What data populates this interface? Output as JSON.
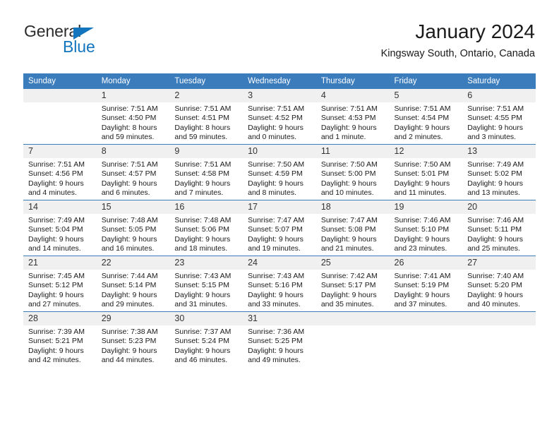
{
  "logo": {
    "word_one": "General",
    "word_two": "Blue",
    "triangle_icon": "triangle-icon",
    "accent_color": "#1275bd"
  },
  "header": {
    "title": "January 2024",
    "subtitle": "Kingsway South, Ontario, Canada"
  },
  "theme": {
    "header_row_bg": "#3b7cbd",
    "daynum_bg": "#f0f0f0",
    "grid_line": "#3b7cbd",
    "text": "#1a1a1a"
  },
  "calendar": {
    "weekday_headers": [
      "Sunday",
      "Monday",
      "Tuesday",
      "Wednesday",
      "Thursday",
      "Friday",
      "Saturday"
    ],
    "weeks": [
      [
        {
          "day": "",
          "sunrise": "",
          "sunset": "",
          "daylight_line1": "",
          "daylight_line2": "",
          "empty": true
        },
        {
          "day": "1",
          "sunrise": "Sunrise: 7:51 AM",
          "sunset": "Sunset: 4:50 PM",
          "daylight_line1": "Daylight: 8 hours",
          "daylight_line2": "and 59 minutes."
        },
        {
          "day": "2",
          "sunrise": "Sunrise: 7:51 AM",
          "sunset": "Sunset: 4:51 PM",
          "daylight_line1": "Daylight: 8 hours",
          "daylight_line2": "and 59 minutes."
        },
        {
          "day": "3",
          "sunrise": "Sunrise: 7:51 AM",
          "sunset": "Sunset: 4:52 PM",
          "daylight_line1": "Daylight: 9 hours",
          "daylight_line2": "and 0 minutes."
        },
        {
          "day": "4",
          "sunrise": "Sunrise: 7:51 AM",
          "sunset": "Sunset: 4:53 PM",
          "daylight_line1": "Daylight: 9 hours",
          "daylight_line2": "and 1 minute."
        },
        {
          "day": "5",
          "sunrise": "Sunrise: 7:51 AM",
          "sunset": "Sunset: 4:54 PM",
          "daylight_line1": "Daylight: 9 hours",
          "daylight_line2": "and 2 minutes."
        },
        {
          "day": "6",
          "sunrise": "Sunrise: 7:51 AM",
          "sunset": "Sunset: 4:55 PM",
          "daylight_line1": "Daylight: 9 hours",
          "daylight_line2": "and 3 minutes."
        }
      ],
      [
        {
          "day": "7",
          "sunrise": "Sunrise: 7:51 AM",
          "sunset": "Sunset: 4:56 PM",
          "daylight_line1": "Daylight: 9 hours",
          "daylight_line2": "and 4 minutes."
        },
        {
          "day": "8",
          "sunrise": "Sunrise: 7:51 AM",
          "sunset": "Sunset: 4:57 PM",
          "daylight_line1": "Daylight: 9 hours",
          "daylight_line2": "and 6 minutes."
        },
        {
          "day": "9",
          "sunrise": "Sunrise: 7:51 AM",
          "sunset": "Sunset: 4:58 PM",
          "daylight_line1": "Daylight: 9 hours",
          "daylight_line2": "and 7 minutes."
        },
        {
          "day": "10",
          "sunrise": "Sunrise: 7:50 AM",
          "sunset": "Sunset: 4:59 PM",
          "daylight_line1": "Daylight: 9 hours",
          "daylight_line2": "and 8 minutes."
        },
        {
          "day": "11",
          "sunrise": "Sunrise: 7:50 AM",
          "sunset": "Sunset: 5:00 PM",
          "daylight_line1": "Daylight: 9 hours",
          "daylight_line2": "and 10 minutes."
        },
        {
          "day": "12",
          "sunrise": "Sunrise: 7:50 AM",
          "sunset": "Sunset: 5:01 PM",
          "daylight_line1": "Daylight: 9 hours",
          "daylight_line2": "and 11 minutes."
        },
        {
          "day": "13",
          "sunrise": "Sunrise: 7:49 AM",
          "sunset": "Sunset: 5:02 PM",
          "daylight_line1": "Daylight: 9 hours",
          "daylight_line2": "and 13 minutes."
        }
      ],
      [
        {
          "day": "14",
          "sunrise": "Sunrise: 7:49 AM",
          "sunset": "Sunset: 5:04 PM",
          "daylight_line1": "Daylight: 9 hours",
          "daylight_line2": "and 14 minutes."
        },
        {
          "day": "15",
          "sunrise": "Sunrise: 7:48 AM",
          "sunset": "Sunset: 5:05 PM",
          "daylight_line1": "Daylight: 9 hours",
          "daylight_line2": "and 16 minutes."
        },
        {
          "day": "16",
          "sunrise": "Sunrise: 7:48 AM",
          "sunset": "Sunset: 5:06 PM",
          "daylight_line1": "Daylight: 9 hours",
          "daylight_line2": "and 18 minutes."
        },
        {
          "day": "17",
          "sunrise": "Sunrise: 7:47 AM",
          "sunset": "Sunset: 5:07 PM",
          "daylight_line1": "Daylight: 9 hours",
          "daylight_line2": "and 19 minutes."
        },
        {
          "day": "18",
          "sunrise": "Sunrise: 7:47 AM",
          "sunset": "Sunset: 5:08 PM",
          "daylight_line1": "Daylight: 9 hours",
          "daylight_line2": "and 21 minutes."
        },
        {
          "day": "19",
          "sunrise": "Sunrise: 7:46 AM",
          "sunset": "Sunset: 5:10 PM",
          "daylight_line1": "Daylight: 9 hours",
          "daylight_line2": "and 23 minutes."
        },
        {
          "day": "20",
          "sunrise": "Sunrise: 7:46 AM",
          "sunset": "Sunset: 5:11 PM",
          "daylight_line1": "Daylight: 9 hours",
          "daylight_line2": "and 25 minutes."
        }
      ],
      [
        {
          "day": "21",
          "sunrise": "Sunrise: 7:45 AM",
          "sunset": "Sunset: 5:12 PM",
          "daylight_line1": "Daylight: 9 hours",
          "daylight_line2": "and 27 minutes."
        },
        {
          "day": "22",
          "sunrise": "Sunrise: 7:44 AM",
          "sunset": "Sunset: 5:14 PM",
          "daylight_line1": "Daylight: 9 hours",
          "daylight_line2": "and 29 minutes."
        },
        {
          "day": "23",
          "sunrise": "Sunrise: 7:43 AM",
          "sunset": "Sunset: 5:15 PM",
          "daylight_line1": "Daylight: 9 hours",
          "daylight_line2": "and 31 minutes."
        },
        {
          "day": "24",
          "sunrise": "Sunrise: 7:43 AM",
          "sunset": "Sunset: 5:16 PM",
          "daylight_line1": "Daylight: 9 hours",
          "daylight_line2": "and 33 minutes."
        },
        {
          "day": "25",
          "sunrise": "Sunrise: 7:42 AM",
          "sunset": "Sunset: 5:17 PM",
          "daylight_line1": "Daylight: 9 hours",
          "daylight_line2": "and 35 minutes."
        },
        {
          "day": "26",
          "sunrise": "Sunrise: 7:41 AM",
          "sunset": "Sunset: 5:19 PM",
          "daylight_line1": "Daylight: 9 hours",
          "daylight_line2": "and 37 minutes."
        },
        {
          "day": "27",
          "sunrise": "Sunrise: 7:40 AM",
          "sunset": "Sunset: 5:20 PM",
          "daylight_line1": "Daylight: 9 hours",
          "daylight_line2": "and 40 minutes."
        }
      ],
      [
        {
          "day": "28",
          "sunrise": "Sunrise: 7:39 AM",
          "sunset": "Sunset: 5:21 PM",
          "daylight_line1": "Daylight: 9 hours",
          "daylight_line2": "and 42 minutes."
        },
        {
          "day": "29",
          "sunrise": "Sunrise: 7:38 AM",
          "sunset": "Sunset: 5:23 PM",
          "daylight_line1": "Daylight: 9 hours",
          "daylight_line2": "and 44 minutes."
        },
        {
          "day": "30",
          "sunrise": "Sunrise: 7:37 AM",
          "sunset": "Sunset: 5:24 PM",
          "daylight_line1": "Daylight: 9 hours",
          "daylight_line2": "and 46 minutes."
        },
        {
          "day": "31",
          "sunrise": "Sunrise: 7:36 AM",
          "sunset": "Sunset: 5:25 PM",
          "daylight_line1": "Daylight: 9 hours",
          "daylight_line2": "and 49 minutes."
        },
        {
          "day": "",
          "sunrise": "",
          "sunset": "",
          "daylight_line1": "",
          "daylight_line2": "",
          "empty": true
        },
        {
          "day": "",
          "sunrise": "",
          "sunset": "",
          "daylight_line1": "",
          "daylight_line2": "",
          "empty": true
        },
        {
          "day": "",
          "sunrise": "",
          "sunset": "",
          "daylight_line1": "",
          "daylight_line2": "",
          "empty": true
        }
      ]
    ]
  }
}
